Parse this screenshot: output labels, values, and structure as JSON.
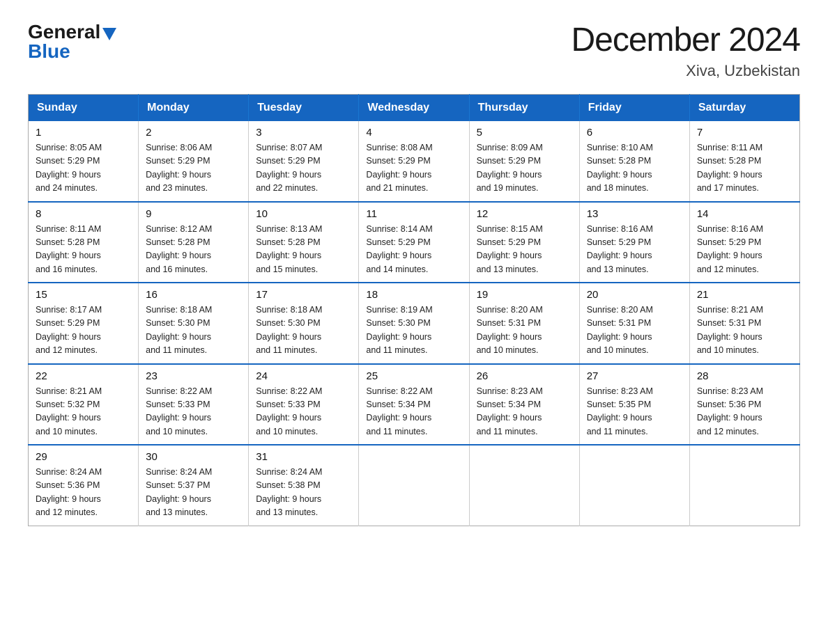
{
  "header": {
    "logo_general": "General",
    "logo_blue": "Blue",
    "month_year": "December 2024",
    "location": "Xiva, Uzbekistan"
  },
  "days_of_week": [
    "Sunday",
    "Monday",
    "Tuesday",
    "Wednesday",
    "Thursday",
    "Friday",
    "Saturday"
  ],
  "weeks": [
    [
      {
        "day": "1",
        "sunrise": "8:05 AM",
        "sunset": "5:29 PM",
        "daylight": "9 hours and 24 minutes."
      },
      {
        "day": "2",
        "sunrise": "8:06 AM",
        "sunset": "5:29 PM",
        "daylight": "9 hours and 23 minutes."
      },
      {
        "day": "3",
        "sunrise": "8:07 AM",
        "sunset": "5:29 PM",
        "daylight": "9 hours and 22 minutes."
      },
      {
        "day": "4",
        "sunrise": "8:08 AM",
        "sunset": "5:29 PM",
        "daylight": "9 hours and 21 minutes."
      },
      {
        "day": "5",
        "sunrise": "8:09 AM",
        "sunset": "5:29 PM",
        "daylight": "9 hours and 19 minutes."
      },
      {
        "day": "6",
        "sunrise": "8:10 AM",
        "sunset": "5:28 PM",
        "daylight": "9 hours and 18 minutes."
      },
      {
        "day": "7",
        "sunrise": "8:11 AM",
        "sunset": "5:28 PM",
        "daylight": "9 hours and 17 minutes."
      }
    ],
    [
      {
        "day": "8",
        "sunrise": "8:11 AM",
        "sunset": "5:28 PM",
        "daylight": "9 hours and 16 minutes."
      },
      {
        "day": "9",
        "sunrise": "8:12 AM",
        "sunset": "5:28 PM",
        "daylight": "9 hours and 16 minutes."
      },
      {
        "day": "10",
        "sunrise": "8:13 AM",
        "sunset": "5:28 PM",
        "daylight": "9 hours and 15 minutes."
      },
      {
        "day": "11",
        "sunrise": "8:14 AM",
        "sunset": "5:29 PM",
        "daylight": "9 hours and 14 minutes."
      },
      {
        "day": "12",
        "sunrise": "8:15 AM",
        "sunset": "5:29 PM",
        "daylight": "9 hours and 13 minutes."
      },
      {
        "day": "13",
        "sunrise": "8:16 AM",
        "sunset": "5:29 PM",
        "daylight": "9 hours and 13 minutes."
      },
      {
        "day": "14",
        "sunrise": "8:16 AM",
        "sunset": "5:29 PM",
        "daylight": "9 hours and 12 minutes."
      }
    ],
    [
      {
        "day": "15",
        "sunrise": "8:17 AM",
        "sunset": "5:29 PM",
        "daylight": "9 hours and 12 minutes."
      },
      {
        "day": "16",
        "sunrise": "8:18 AM",
        "sunset": "5:30 PM",
        "daylight": "9 hours and 11 minutes."
      },
      {
        "day": "17",
        "sunrise": "8:18 AM",
        "sunset": "5:30 PM",
        "daylight": "9 hours and 11 minutes."
      },
      {
        "day": "18",
        "sunrise": "8:19 AM",
        "sunset": "5:30 PM",
        "daylight": "9 hours and 11 minutes."
      },
      {
        "day": "19",
        "sunrise": "8:20 AM",
        "sunset": "5:31 PM",
        "daylight": "9 hours and 10 minutes."
      },
      {
        "day": "20",
        "sunrise": "8:20 AM",
        "sunset": "5:31 PM",
        "daylight": "9 hours and 10 minutes."
      },
      {
        "day": "21",
        "sunrise": "8:21 AM",
        "sunset": "5:31 PM",
        "daylight": "9 hours and 10 minutes."
      }
    ],
    [
      {
        "day": "22",
        "sunrise": "8:21 AM",
        "sunset": "5:32 PM",
        "daylight": "9 hours and 10 minutes."
      },
      {
        "day": "23",
        "sunrise": "8:22 AM",
        "sunset": "5:33 PM",
        "daylight": "9 hours and 10 minutes."
      },
      {
        "day": "24",
        "sunrise": "8:22 AM",
        "sunset": "5:33 PM",
        "daylight": "9 hours and 10 minutes."
      },
      {
        "day": "25",
        "sunrise": "8:22 AM",
        "sunset": "5:34 PM",
        "daylight": "9 hours and 11 minutes."
      },
      {
        "day": "26",
        "sunrise": "8:23 AM",
        "sunset": "5:34 PM",
        "daylight": "9 hours and 11 minutes."
      },
      {
        "day": "27",
        "sunrise": "8:23 AM",
        "sunset": "5:35 PM",
        "daylight": "9 hours and 11 minutes."
      },
      {
        "day": "28",
        "sunrise": "8:23 AM",
        "sunset": "5:36 PM",
        "daylight": "9 hours and 12 minutes."
      }
    ],
    [
      {
        "day": "29",
        "sunrise": "8:24 AM",
        "sunset": "5:36 PM",
        "daylight": "9 hours and 12 minutes."
      },
      {
        "day": "30",
        "sunrise": "8:24 AM",
        "sunset": "5:37 PM",
        "daylight": "9 hours and 13 minutes."
      },
      {
        "day": "31",
        "sunrise": "8:24 AM",
        "sunset": "5:38 PM",
        "daylight": "9 hours and 13 minutes."
      },
      null,
      null,
      null,
      null
    ]
  ],
  "labels": {
    "sunrise": "Sunrise:",
    "sunset": "Sunset:",
    "daylight": "Daylight:"
  }
}
